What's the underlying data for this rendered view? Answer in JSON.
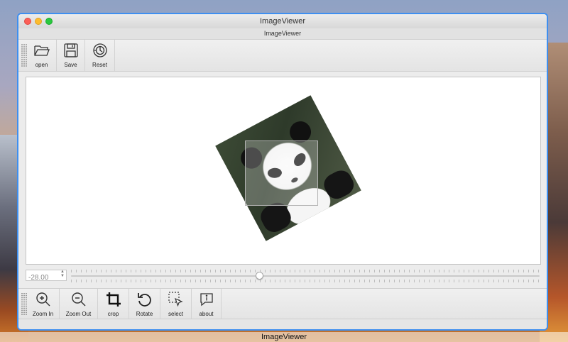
{
  "window": {
    "title": "ImageViewer",
    "subtitle": "ImageViewer"
  },
  "desktop": {
    "caption": "ImageViewer"
  },
  "toolbar_top": {
    "items": [
      {
        "label": "open",
        "icon": "folder-open-icon"
      },
      {
        "label": "Save",
        "icon": "floppy-disk-icon"
      },
      {
        "label": "Reset",
        "icon": "reset-icon"
      }
    ]
  },
  "slider": {
    "value": "-28.00",
    "position_fraction": 0.4
  },
  "image": {
    "rotation_deg": -28
  },
  "toolbar_bottom": {
    "items": [
      {
        "label": "Zoom In",
        "icon": "zoom-in-icon"
      },
      {
        "label": "Zoom Out",
        "icon": "zoom-out-icon"
      },
      {
        "label": "crop",
        "icon": "crop-icon"
      },
      {
        "label": "Rotate",
        "icon": "rotate-icon"
      },
      {
        "label": "select",
        "icon": "select-icon"
      },
      {
        "label": "about",
        "icon": "about-icon"
      }
    ]
  },
  "colors": {
    "window_border": "#3e8ff0",
    "close": "#fc5f57",
    "minimize": "#fdbc2e",
    "maximize": "#2ac840"
  }
}
